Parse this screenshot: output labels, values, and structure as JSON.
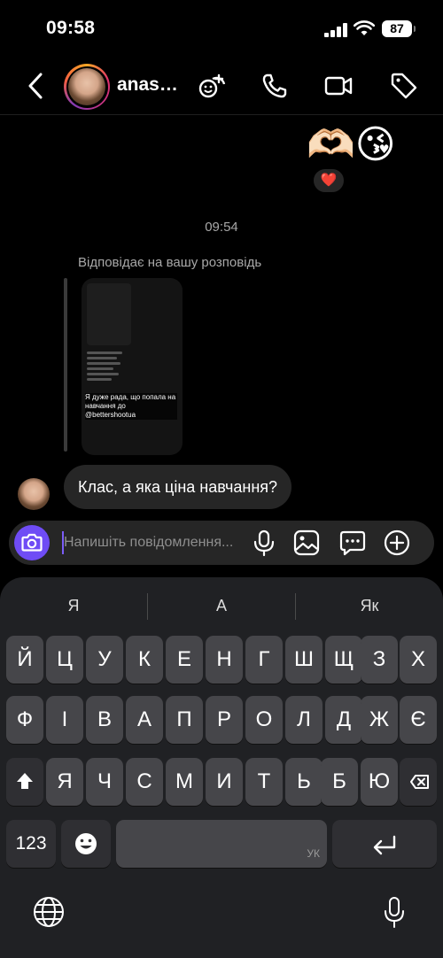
{
  "status": {
    "time": "09:58",
    "battery": "87"
  },
  "header": {
    "contact_name": "anas…"
  },
  "thread": {
    "sent_emojis": "🫶🏻😘",
    "reaction": "❤️",
    "timestamp": "09:54",
    "reply_label": "Відповідає на вашу розповідь",
    "story_caption": "Я дуже рада, що попала на навчання до @bettershootua",
    "incoming_message": "Клас, а яка ціна навчання?"
  },
  "composer": {
    "placeholder": "Напишіть повідомлення..."
  },
  "keyboard": {
    "suggestions": [
      "Я",
      "А",
      "Як"
    ],
    "row1": [
      "Й",
      "Ц",
      "У",
      "К",
      "Е",
      "Н",
      "Г",
      "Ш",
      "Щ",
      "З",
      "Х"
    ],
    "row2": [
      "Ф",
      "І",
      "В",
      "А",
      "П",
      "Р",
      "О",
      "Л",
      "Д",
      "Ж",
      "Є"
    ],
    "row3": [
      "Я",
      "Ч",
      "С",
      "М",
      "И",
      "Т",
      "Ь",
      "Б",
      "Ю"
    ],
    "numbers_key": "123",
    "space_label": "УК"
  }
}
